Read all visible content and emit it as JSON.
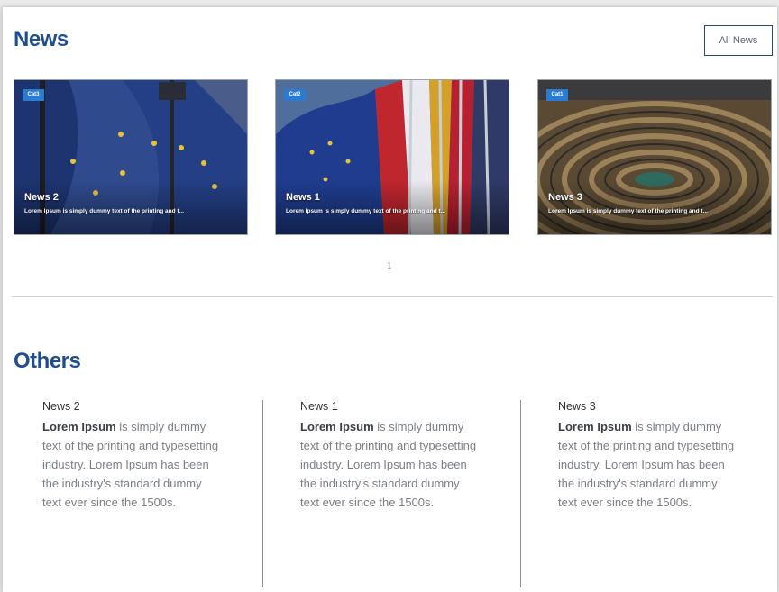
{
  "header": {
    "title": "News",
    "all_news_label": "All News"
  },
  "cards": [
    {
      "badge": "Cat3",
      "title": "News 2",
      "desc": "Lorem Ipsum is simply dummy text of the printing and t..."
    },
    {
      "badge": "Cat2",
      "title": "News 1",
      "desc": "Lorem Ipsum is simply dummy text of the printing and t..."
    },
    {
      "badge": "Cat1",
      "title": "News 3",
      "desc": "Lorem Ipsum is simply dummy text of the printing and t..."
    }
  ],
  "pager": {
    "current": "1"
  },
  "others": {
    "title": "Others",
    "items": [
      {
        "title": "News 2",
        "lead": "Lorem Ipsum",
        "text": " is simply dummy text of the printing and typesetting industry. Lorem Ipsum has been the industry's standard dummy text ever since the 1500s."
      },
      {
        "title": "News 1",
        "lead": "Lorem Ipsum",
        "text": " is simply dummy text of the printing and typesetting industry. Lorem Ipsum has been the industry's standard dummy text ever since the 1500s."
      },
      {
        "title": "News 3",
        "lead": "Lorem Ipsum",
        "text": " is simply dummy text of the printing and typesetting industry. Lorem Ipsum has been the industry's standard dummy text ever since the 1500s."
      }
    ]
  },
  "colors": {
    "heading": "#1f4e8c",
    "badge": "#2b7bd3",
    "button_border": "#244a7c"
  },
  "images": [
    "eu-flag-photo",
    "flags-row-photo",
    "parliament-hemicycle-photo"
  ]
}
